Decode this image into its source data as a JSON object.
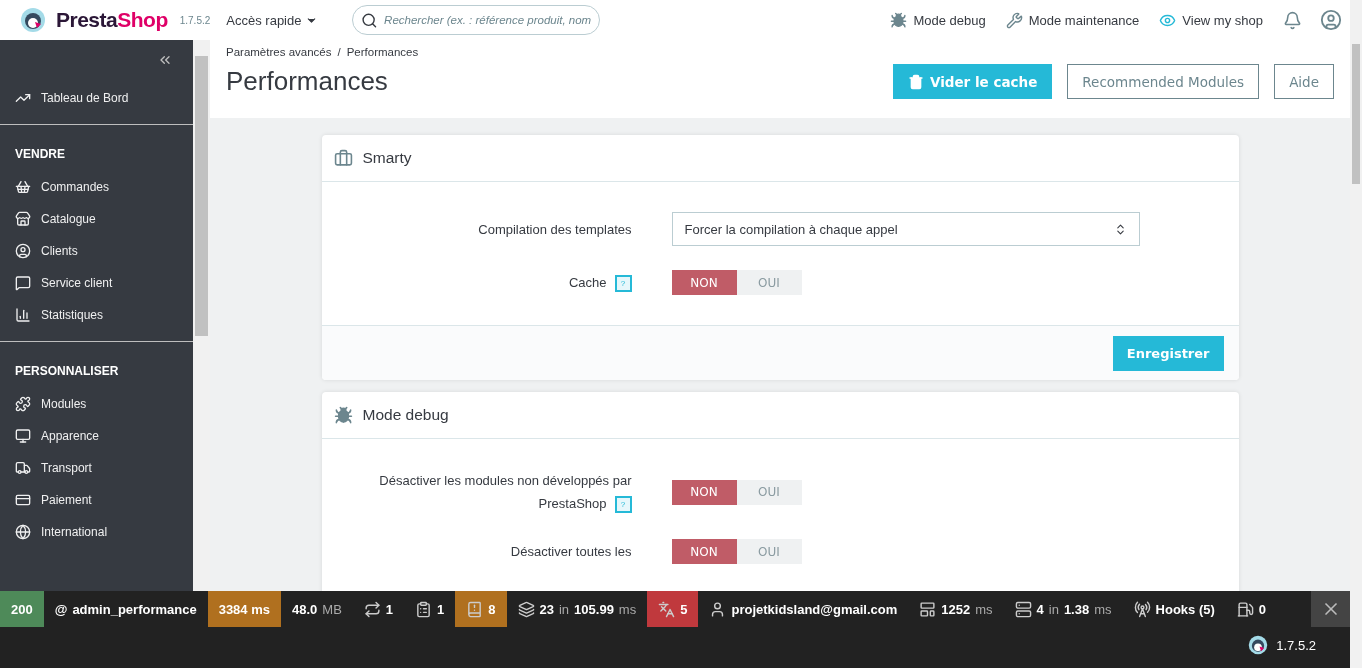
{
  "header": {
    "brand": [
      "Presta",
      "Shop"
    ],
    "version": "1.7.5.2",
    "quick_access": "Accès rapide",
    "search": {
      "placeholder": "Rechercher (ex. : référence produit, nom"
    },
    "actions": [
      {
        "kind": "debug",
        "label": "Mode debug"
      },
      {
        "kind": "maintenance",
        "label": "Mode maintenance"
      },
      {
        "kind": "shop",
        "label": "View my shop"
      }
    ]
  },
  "sidebar": {
    "sections": [
      {
        "items": [
          {
            "label": "Tableau de Bord"
          }
        ]
      },
      {
        "title": "VENDRE",
        "items": [
          {
            "label": "Commandes"
          },
          {
            "label": "Catalogue"
          },
          {
            "label": "Clients"
          },
          {
            "label": "Service client"
          },
          {
            "label": "Statistiques"
          }
        ]
      },
      {
        "title": "PERSONNALISER",
        "items": [
          {
            "label": "Modules"
          },
          {
            "label": "Apparence"
          },
          {
            "label": "Transport"
          },
          {
            "label": "Paiement"
          },
          {
            "label": "International"
          }
        ]
      }
    ]
  },
  "breadcrumb": {
    "items": [
      "Paramètres avancés",
      "Performances"
    ],
    "separator": "/"
  },
  "title": "Performances",
  "toolbar": [
    {
      "kind": "primary",
      "label": "Vider le cache"
    },
    {
      "kind": "outline",
      "label": "Recommended Modules"
    },
    {
      "kind": "outline",
      "label": "Aide"
    }
  ],
  "panels": [
    {
      "kind": "smarty",
      "title": "Smarty",
      "rows": [
        {
          "kind": "select",
          "label": "Compilation des templates",
          "value": "Forcer la compilation à chaque appel"
        },
        {
          "kind": "switch",
          "label": "Cache",
          "help": "?",
          "options": [
            {
              "label": "NON",
              "selected": true
            },
            {
              "label": "OUI",
              "selected": false
            }
          ]
        }
      ],
      "button": "Enregistrer"
    },
    {
      "kind": "debug",
      "title": "Mode debug",
      "rows": [
        {
          "kind": "switch",
          "label": "Désactiver les modules non développés par PrestaShop",
          "help": "?",
          "options": [
            {
              "label": "NON",
              "selected": true
            },
            {
              "label": "OUI",
              "selected": false
            }
          ]
        },
        {
          "kind": "switch",
          "label": "Désactiver toutes les",
          "options": [
            {
              "label": "NON",
              "selected": true
            },
            {
              "label": "OUI",
              "selected": false
            }
          ]
        }
      ]
    }
  ],
  "debug_bar": {
    "items": [
      {
        "kind": "status",
        "color": "#4e8a59",
        "parts": [
          {
            "text": "200",
            "muted": false
          }
        ]
      },
      {
        "kind": "route",
        "parts": [
          {
            "text": "@",
            "muted": false
          },
          {
            "text": "admin_performance",
            "muted": false
          }
        ]
      },
      {
        "kind": "time",
        "color": "#b0701f",
        "parts": [
          {
            "text": "3384 ms",
            "muted": false
          }
        ]
      },
      {
        "kind": "memory",
        "parts": [
          {
            "text": "48.0",
            "muted": false
          },
          {
            "text": "MB",
            "muted": true
          }
        ]
      },
      {
        "kind": "redirect",
        "parts": [
          {
            "text": "1",
            "muted": false
          }
        ]
      },
      {
        "kind": "logs",
        "parts": [
          {
            "text": "1",
            "muted": false
          }
        ]
      },
      {
        "kind": "notices",
        "color": "#b0701f",
        "parts": [
          {
            "text": "8",
            "muted": false
          }
        ]
      },
      {
        "kind": "database",
        "parts": [
          {
            "text": "23",
            "muted": false
          },
          {
            "text": "in",
            "muted": true
          },
          {
            "text": "105.99",
            "muted": false
          },
          {
            "text": "ms",
            "muted": true
          }
        ]
      },
      {
        "kind": "translations",
        "color": "#c0393d",
        "parts": [
          {
            "text": "5",
            "muted": false
          }
        ]
      },
      {
        "kind": "user",
        "parts": [
          {
            "text": "projetkidsland@gmail.com",
            "muted": false
          }
        ]
      },
      {
        "kind": "template",
        "parts": [
          {
            "text": "1252",
            "muted": false
          },
          {
            "text": "ms",
            "muted": true
          }
        ]
      },
      {
        "kind": "cache",
        "parts": [
          {
            "text": "4",
            "muted": false
          },
          {
            "text": "in",
            "muted": true
          },
          {
            "text": "1.38",
            "muted": false
          },
          {
            "text": "ms",
            "muted": true
          }
        ]
      },
      {
        "kind": "hooks",
        "parts": [
          {
            "text": "Hooks (5)",
            "muted": false
          }
        ]
      },
      {
        "kind": "fuel",
        "parts": [
          {
            "text": "0",
            "muted": false
          }
        ]
      }
    ],
    "version": "1.7.5.2"
  }
}
